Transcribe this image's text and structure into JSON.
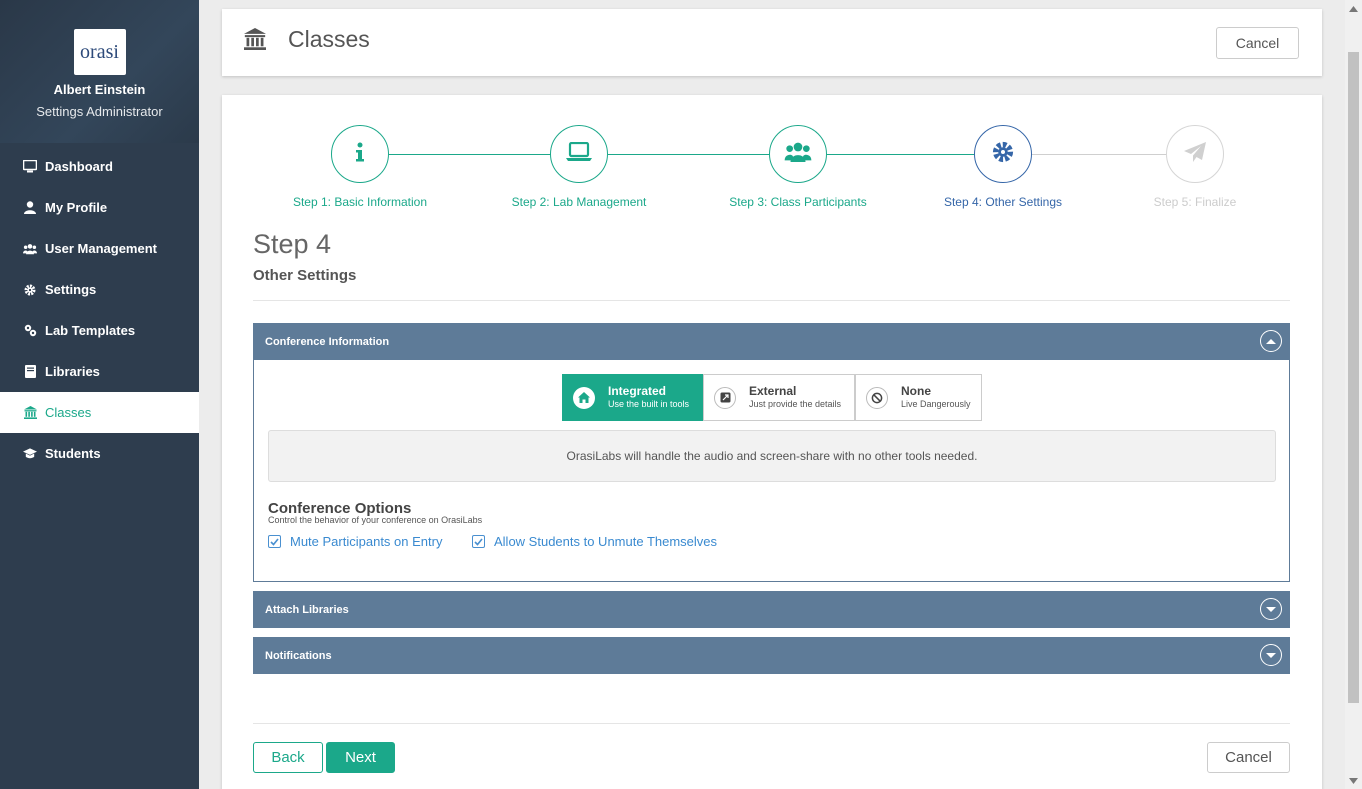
{
  "user": {
    "name": "Albert Einstein",
    "role": "Settings Administrator",
    "logo_text": "orasi"
  },
  "nav": [
    {
      "label": "Dashboard",
      "icon": "monitor-icon"
    },
    {
      "label": "My Profile",
      "icon": "user-icon"
    },
    {
      "label": "User Management",
      "icon": "users-icon"
    },
    {
      "label": "Settings",
      "icon": "gear-icon"
    },
    {
      "label": "Lab Templates",
      "icon": "flask-icon"
    },
    {
      "label": "Libraries",
      "icon": "book-icon"
    },
    {
      "label": "Classes",
      "icon": "institution-icon",
      "active": true
    },
    {
      "label": "Students",
      "icon": "graduation-cap-icon"
    }
  ],
  "header": {
    "title": "Classes",
    "cancel_label": "Cancel"
  },
  "steps": [
    {
      "label": "Step 1: Basic Information",
      "icon": "info-icon",
      "state": "done"
    },
    {
      "label": "Step 2: Lab Management",
      "icon": "laptop-icon",
      "state": "done"
    },
    {
      "label": "Step 3: Class Participants",
      "icon": "users-icon",
      "state": "done"
    },
    {
      "label": "Step 4: Other Settings",
      "icon": "gear-icon",
      "state": "current"
    },
    {
      "label": "Step 5: Finalize",
      "icon": "paper-plane-icon",
      "state": "future"
    }
  ],
  "step_heading": "Step 4",
  "step_subheading": "Other Settings",
  "panels": {
    "conference": {
      "title": "Conference Information",
      "options": [
        {
          "title": "Integrated",
          "desc": "Use the built in tools",
          "icon": "home-icon",
          "selected": true
        },
        {
          "title": "External",
          "desc": "Just provide the details",
          "icon": "external-link-icon",
          "selected": false
        },
        {
          "title": "None",
          "desc": "Live Dangerously",
          "icon": "ban-icon",
          "selected": false
        }
      ],
      "info": "OrasiLabs will handle the audio and screen-share with no other tools needed.",
      "options_title": "Conference Options",
      "options_desc": "Control the behavior of your conference on OrasiLabs",
      "checks": [
        {
          "label": "Mute Participants on Entry",
          "checked": true
        },
        {
          "label": "Allow Students to Unmute Themselves",
          "checked": true
        }
      ]
    },
    "libraries": {
      "title": "Attach Libraries"
    },
    "notifications": {
      "title": "Notifications"
    }
  },
  "footer": {
    "back_label": "Back",
    "next_label": "Next",
    "cancel_label": "Cancel"
  },
  "colors": {
    "accent": "#1ba88a",
    "sidebar": "#2e3d4e",
    "panel": "#5e7b98",
    "current_step": "#3566a8"
  }
}
